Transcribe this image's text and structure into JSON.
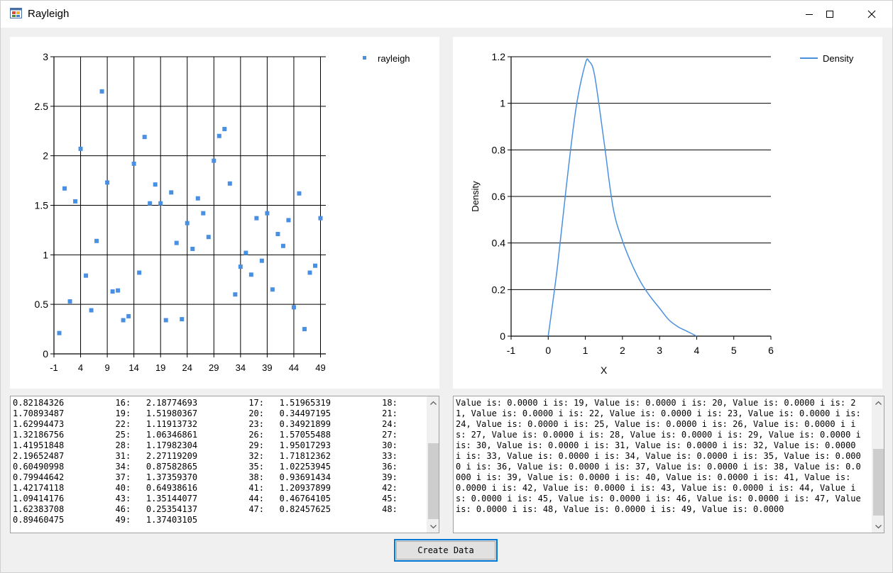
{
  "window": {
    "title": "Rayleigh",
    "icon": "windows-form-icon",
    "controls": [
      "minimize-icon",
      "maximize-icon",
      "close-icon"
    ]
  },
  "chart_data": [
    {
      "type": "scatter",
      "title": "",
      "xlabel": "",
      "ylabel": "",
      "xlim": [
        -1,
        50
      ],
      "ylim": [
        0,
        3
      ],
      "x_ticks": [
        "-1",
        "4",
        "9",
        "14",
        "19",
        "24",
        "29",
        "34",
        "39",
        "44",
        "49"
      ],
      "y_ticks": [
        "0",
        "0.5",
        "1",
        "1.5",
        "2",
        "2.5",
        "3"
      ],
      "grid": true,
      "legend_position": "top-right",
      "series": [
        {
          "name": "rayleigh",
          "color": "#4a90e2",
          "x": [
            0,
            1,
            2,
            3,
            4,
            5,
            6,
            7,
            8,
            9,
            10,
            11,
            12,
            13,
            14,
            15,
            16,
            17,
            18,
            19,
            20,
            21,
            22,
            23,
            24,
            25,
            26,
            27,
            28,
            29,
            30,
            31,
            32,
            33,
            34,
            35,
            36,
            37,
            38,
            39,
            40,
            41,
            42,
            43,
            44,
            45,
            46,
            47,
            48,
            49
          ],
          "y": [
            0.21,
            1.67,
            0.53,
            1.54,
            2.07,
            0.79,
            0.44,
            1.14,
            2.65,
            1.73,
            0.63,
            0.64,
            0.34,
            0.38,
            1.92,
            0.82,
            2.19,
            1.52,
            1.71,
            1.52,
            0.34,
            1.63,
            1.12,
            0.35,
            1.32,
            1.06,
            1.57,
            1.42,
            1.18,
            1.95,
            2.2,
            2.27,
            1.72,
            0.6,
            0.88,
            1.02,
            0.8,
            1.37,
            0.94,
            1.42,
            0.65,
            1.21,
            1.09,
            1.35,
            0.47,
            1.62,
            0.25,
            0.82,
            0.89,
            1.37
          ]
        }
      ]
    },
    {
      "type": "line",
      "title": "",
      "xlabel": "X",
      "ylabel": "Density",
      "xlim": [
        -1,
        6
      ],
      "ylim": [
        0,
        1.2
      ],
      "x_ticks": [
        "-1",
        "0",
        "1",
        "2",
        "3",
        "4",
        "5",
        "6"
      ],
      "y_ticks": [
        "0",
        "0.2",
        "0.4",
        "0.6",
        "0.8",
        "1",
        "1.2"
      ],
      "grid": "horizontal",
      "legend_position": "top-right",
      "series": [
        {
          "name": "Density",
          "color": "#4a90e2",
          "x": [
            0,
            0.25,
            0.5,
            0.75,
            1.0,
            1.1,
            1.25,
            1.5,
            1.75,
            2.0,
            2.25,
            2.5,
            2.75,
            3.0,
            3.25,
            3.5,
            3.75,
            4.0
          ],
          "y": [
            0,
            0.3,
            0.66,
            0.98,
            1.17,
            1.18,
            1.12,
            0.84,
            0.55,
            0.41,
            0.31,
            0.23,
            0.17,
            0.12,
            0.07,
            0.04,
            0.02,
            0.0
          ]
        }
      ]
    }
  ],
  "left_text": {
    "lines": [
      "0.82184326          16:   2.18774693          17:   1.51965319          18:",
      "1.70893487          19:   1.51980367          20:   0.34497195          21:",
      "1.62994473          22:   1.11913732          23:   0.34921899          24:",
      "1.32186756          25:   1.06346861          26:   1.57055488          27:",
      "1.41951848          28:   1.17982304          29:   1.95017293          30:",
      "2.19652487          31:   2.27119209          32:   1.71812362          33:",
      "0.60490998          34:   0.87582865          35:   1.02253945          36:",
      "0.79944642          37:   1.37359370          38:   0.93691434          39:",
      "1.42174118          40:   0.64938616          41:   1.20937899          42:",
      "1.09414176          43:   1.35144077          44:   0.46764105          45:",
      "1.62383708          46:   0.25354137          47:   0.82457625          48:",
      "0.89460475          49:   1.37403105"
    ]
  },
  "right_text": {
    "content": "Value is: 0.0000  i is: 19,  Value is: 0.0000  i is: 20,  Value is: 0.0000  i is: 21,  Value is: 0.0000  i is: 22,  Value is: 0.0000  i is: 23,  Value is: 0.0000  i is: 24,  Value is: 0.0000  i is: 25,  Value is: 0.0000  i is: 26,  Value is: 0.0000  i is: 27,  Value is: 0.0000  i is: 28,  Value is: 0.0000  i is: 29,  Value is: 0.0000  i is: 30,  Value is: 0.0000  i is: 31,  Value is: 0.0000  i is: 32,  Value is: 0.0000  i is: 33,  Value is: 0.0000  i is: 34,  Value is: 0.0000  i is: 35,  Value is: 0.0000  i is: 36,  Value is: 0.0000  i is: 37,  Value is: 0.0000  i is: 38,  Value is: 0.0000  i is: 39,  Value is: 0.0000  i is: 40,  Value is: 0.0000  i is: 41,  Value is: 0.0000  i is: 42,  Value is: 0.0000  i is: 43,  Value is: 0.0000  i is: 44,  Value is: 0.0000  i is: 45,  Value is: 0.0000  i is: 46,  Value is: 0.0000  i is: 47,  Value is: 0.0000  i is: 48,  Value is: 0.0000  i is: 49,  Value is: 0.0000"
  },
  "button": {
    "label": "Create Data"
  }
}
